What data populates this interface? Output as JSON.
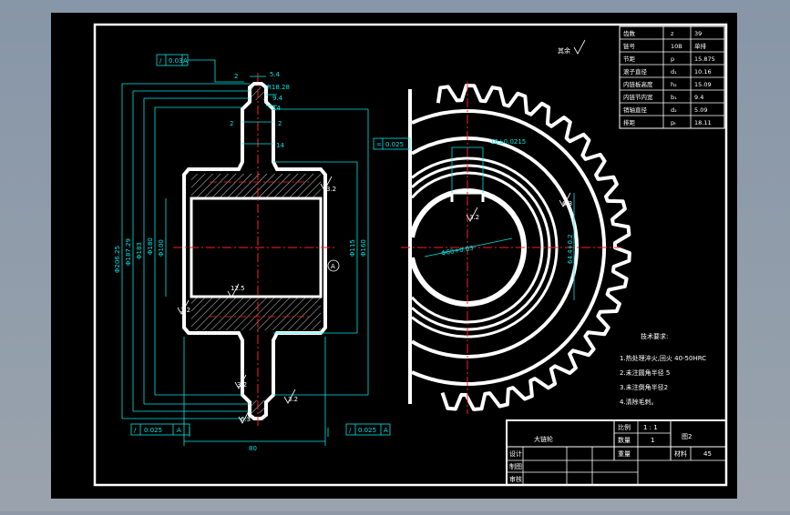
{
  "colors": {
    "sheet": "#000000",
    "outline": "#ffffff",
    "dimension": "#00e5e5",
    "centerline": "#ff2020",
    "background": "#8e98a6"
  },
  "roughness_note": "其余",
  "param_table": [
    {
      "name": "齿数",
      "sym": "z",
      "value": "39"
    },
    {
      "name": "链号",
      "sym": "10B",
      "value": "单排"
    },
    {
      "name": "节距",
      "sym": "p",
      "value": "15.875"
    },
    {
      "name": "滚子直径",
      "sym": "d₁",
      "value": "10.16"
    },
    {
      "name": "内链板高度",
      "sym": "h₂",
      "value": "15.09"
    },
    {
      "name": "内链节内宽",
      "sym": "b₁",
      "value": "9.4"
    },
    {
      "name": "销轴直径",
      "sym": "d₂",
      "value": "5.09"
    },
    {
      "name": "排距",
      "sym": "pₜ",
      "value": "18.11"
    }
  ],
  "tech_req": {
    "title": "技术要求:",
    "items": [
      "1.热处理淬火,回火  40-50HRC",
      "2.未注圆角半径 5",
      "3.未注倒角半径2",
      "4.清除毛刺。"
    ]
  },
  "title_block": {
    "part_name": "大链轮",
    "scale_label": "比例",
    "scale_value": "1 : 1",
    "qty_label": "数量",
    "qty_value": "1",
    "weight_label": "重量",
    "drawing_no": "图2",
    "material_label": "材料",
    "material_value": "45",
    "design_label": "设计",
    "draw_label": "制图",
    "review_label": "审核"
  },
  "left_dims": {
    "top_5_4": "5.4",
    "r18": "R18.28",
    "w94": "9.4",
    "w2a": "2",
    "w2b": "2",
    "w14a": "14",
    "w2c": "2",
    "w14b": "14",
    "d_outer": "Φ206.25",
    "d_187": "Φ187.29",
    "d_183": "Φ183",
    "d_180": "Φ180",
    "d_100": "Φ100",
    "d_115": "Φ115",
    "d_160": "Φ160",
    "width_80": "80",
    "runout_top": "0.03",
    "runout_left": "0.025",
    "runout_right": "0.025",
    "datum": "A",
    "r3_2": "3.2",
    "r12_5": "12.5",
    "r6_3": "6.3"
  },
  "right_dims": {
    "keyway_sym": "0.025",
    "keyway_w": "16±0.0215",
    "bore": "Φ60+0.03",
    "key_depth": "64.4+0.2",
    "r6_3": "6.3",
    "r3_2": "3.2"
  }
}
